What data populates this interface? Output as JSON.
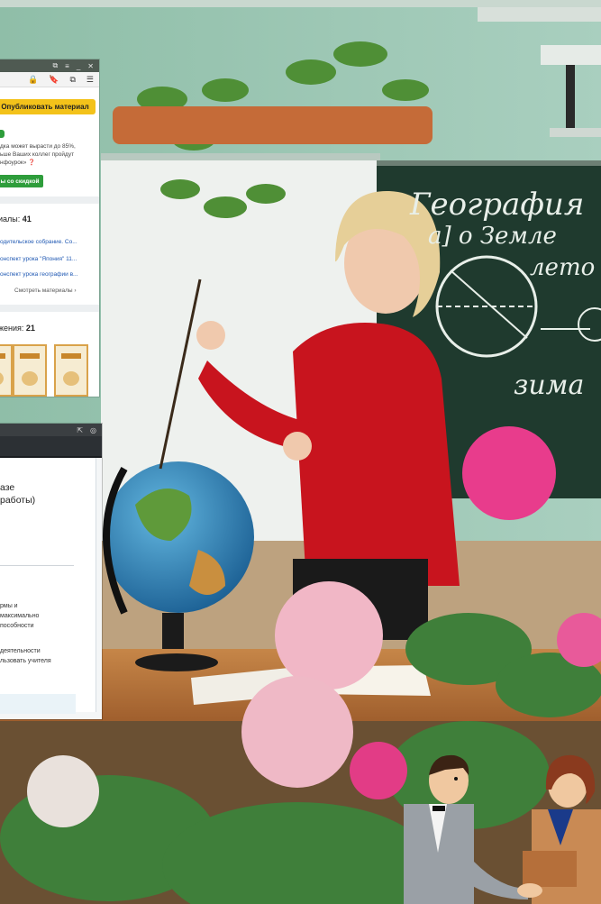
{
  "photo": {
    "description_icon": "classroom-photo",
    "board_text": {
      "line1": "География",
      "line2": "а] о Земле",
      "line3": "лето",
      "line4": "зима"
    }
  },
  "profile_panel": {
    "browser_icons": [
      "tab-icon",
      "menu-icon",
      "minimize-icon",
      "close-icon"
    ],
    "toolbar_icons": [
      "lock-icon",
      "bookmark-icon",
      "collections-icon",
      "profile-icon"
    ],
    "publish_button": "Опубликовать материал",
    "description_lines": [
      "дка может вырасти до 85%,",
      "ьше Ваших коллег пройдут",
      "нфоурок» ❓"
    ],
    "discount_button": "ы со скидкой",
    "materials_label": "иалы:",
    "materials_count": "41",
    "materials": [
      "одительское собрание. Со...",
      "онспект урока \"Япония\" 11...",
      "онспект урока географии в..."
    ],
    "see_all": "Смотреть материалы ›",
    "achievements_label": "жения:",
    "achievements_count": "21"
  },
  "document_panel": {
    "header_icons": [
      "share-icon",
      "camera-icon"
    ],
    "title_lines": [
      "азе",
      "работы)"
    ],
    "paragraph1": [
      "рмы и",
      "максимально",
      "пособности"
    ],
    "paragraph2": [
      "деятельности",
      "льзовать учителя"
    ]
  },
  "colors": {
    "board": "#1f3a2e",
    "wall": "#9fc7b4",
    "blouse": "#c8141e",
    "publish": "#f3c21a",
    "discount": "#2e9d3b",
    "link": "#1f58b3"
  }
}
